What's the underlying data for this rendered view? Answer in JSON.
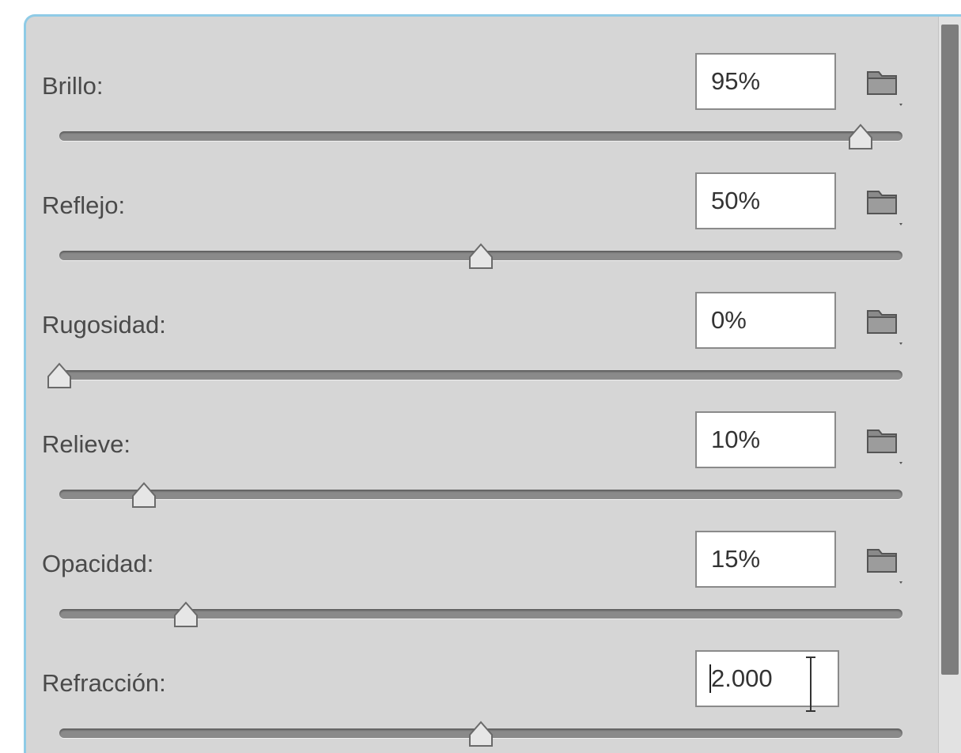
{
  "panel": {
    "rows": [
      {
        "label": "Brillo:",
        "value": "95%",
        "level": 0.95
      },
      {
        "label": "Reflejo:",
        "value": "50%",
        "level": 0.5
      },
      {
        "label": "Rugosidad:",
        "value": "0%",
        "level": 0.0
      },
      {
        "label": "Relieve:",
        "value": "10%",
        "level": 0.1
      },
      {
        "label": "Opacidad:",
        "value": "15%",
        "level": 0.15
      },
      {
        "label": "Refracción:",
        "value": "2.000",
        "level": 0.5
      }
    ],
    "icons": {
      "folder": "folder-icon",
      "thumb": "slider-thumb-icon"
    }
  },
  "colors": {
    "panel_bg": "#d6d6d6",
    "accent_border": "#8fcbe6",
    "track": "#8a8a8a",
    "text": "#4a4a4a"
  }
}
